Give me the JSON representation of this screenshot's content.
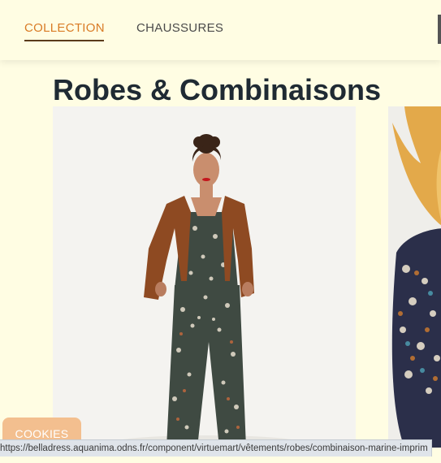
{
  "nav": {
    "items": [
      {
        "label": "COLLECTION",
        "active": true
      },
      {
        "label": "CHAUSSURES",
        "active": false
      }
    ]
  },
  "heading": "Robes & Combinaisons",
  "products": [
    {
      "image": "product-photo-woman-floral-jumpsuit-rust-cardigan"
    },
    {
      "image": "product-photo-woman-floral-blouse-partial"
    }
  ],
  "cookies": {
    "label": "COOKIES"
  },
  "status_bar": {
    "url": "https://belladress.aquanima.odns.fr/component/virtuemart/vêtements/robes/combinaison-marine-imprim"
  },
  "colors": {
    "background": "#fffde3",
    "accent": "#d97b25",
    "heading": "#1f2a33",
    "cookies": "#f3bf8f"
  }
}
